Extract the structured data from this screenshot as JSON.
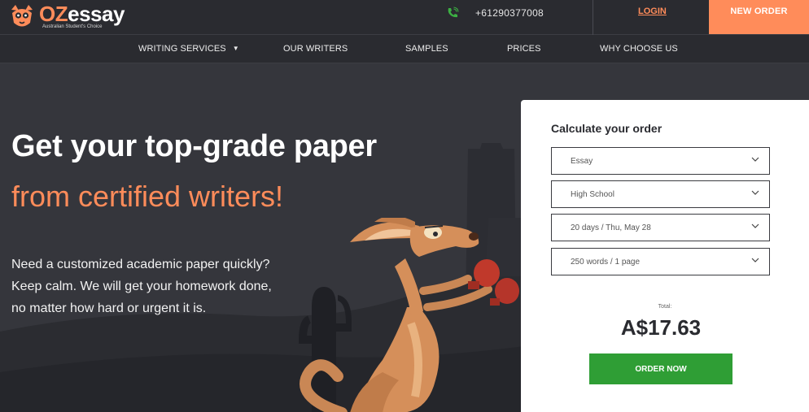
{
  "header": {
    "logo_oz": "OZ",
    "logo_essay": "essay",
    "logo_tagline": "Australian Student's Choice",
    "phone": "+61290377008",
    "login_label": "LOGIN",
    "new_order_label": "NEW ORDER"
  },
  "nav": {
    "items": [
      {
        "label": "WRITING SERVICES",
        "has_dropdown": true
      },
      {
        "label": "OUR WRITERS"
      },
      {
        "label": "SAMPLES"
      },
      {
        "label": "PRICES"
      },
      {
        "label": "WHY CHOOSE US"
      }
    ]
  },
  "hero": {
    "title": "Get your top-grade paper",
    "subtitle": "from certified writers!",
    "description": [
      "Need a customized academic paper quickly?",
      "Keep calm. We will get your homework done,",
      "no matter how hard or urgent it is."
    ]
  },
  "calculator": {
    "title": "Calculate your order",
    "type": "Essay",
    "level": "High School",
    "deadline": "20 days / Thu, May 28",
    "pages": "250 words / 1 page",
    "total_label": "Total:",
    "total_price": "A$17.63",
    "order_button": "ORDER NOW"
  },
  "colors": {
    "accent": "#ff8c5a",
    "background": "#2a2b30",
    "order_green": "#2f9e35"
  },
  "icons": [
    "logo-mascot-icon",
    "phone-icon",
    "chevron-down-icon"
  ]
}
